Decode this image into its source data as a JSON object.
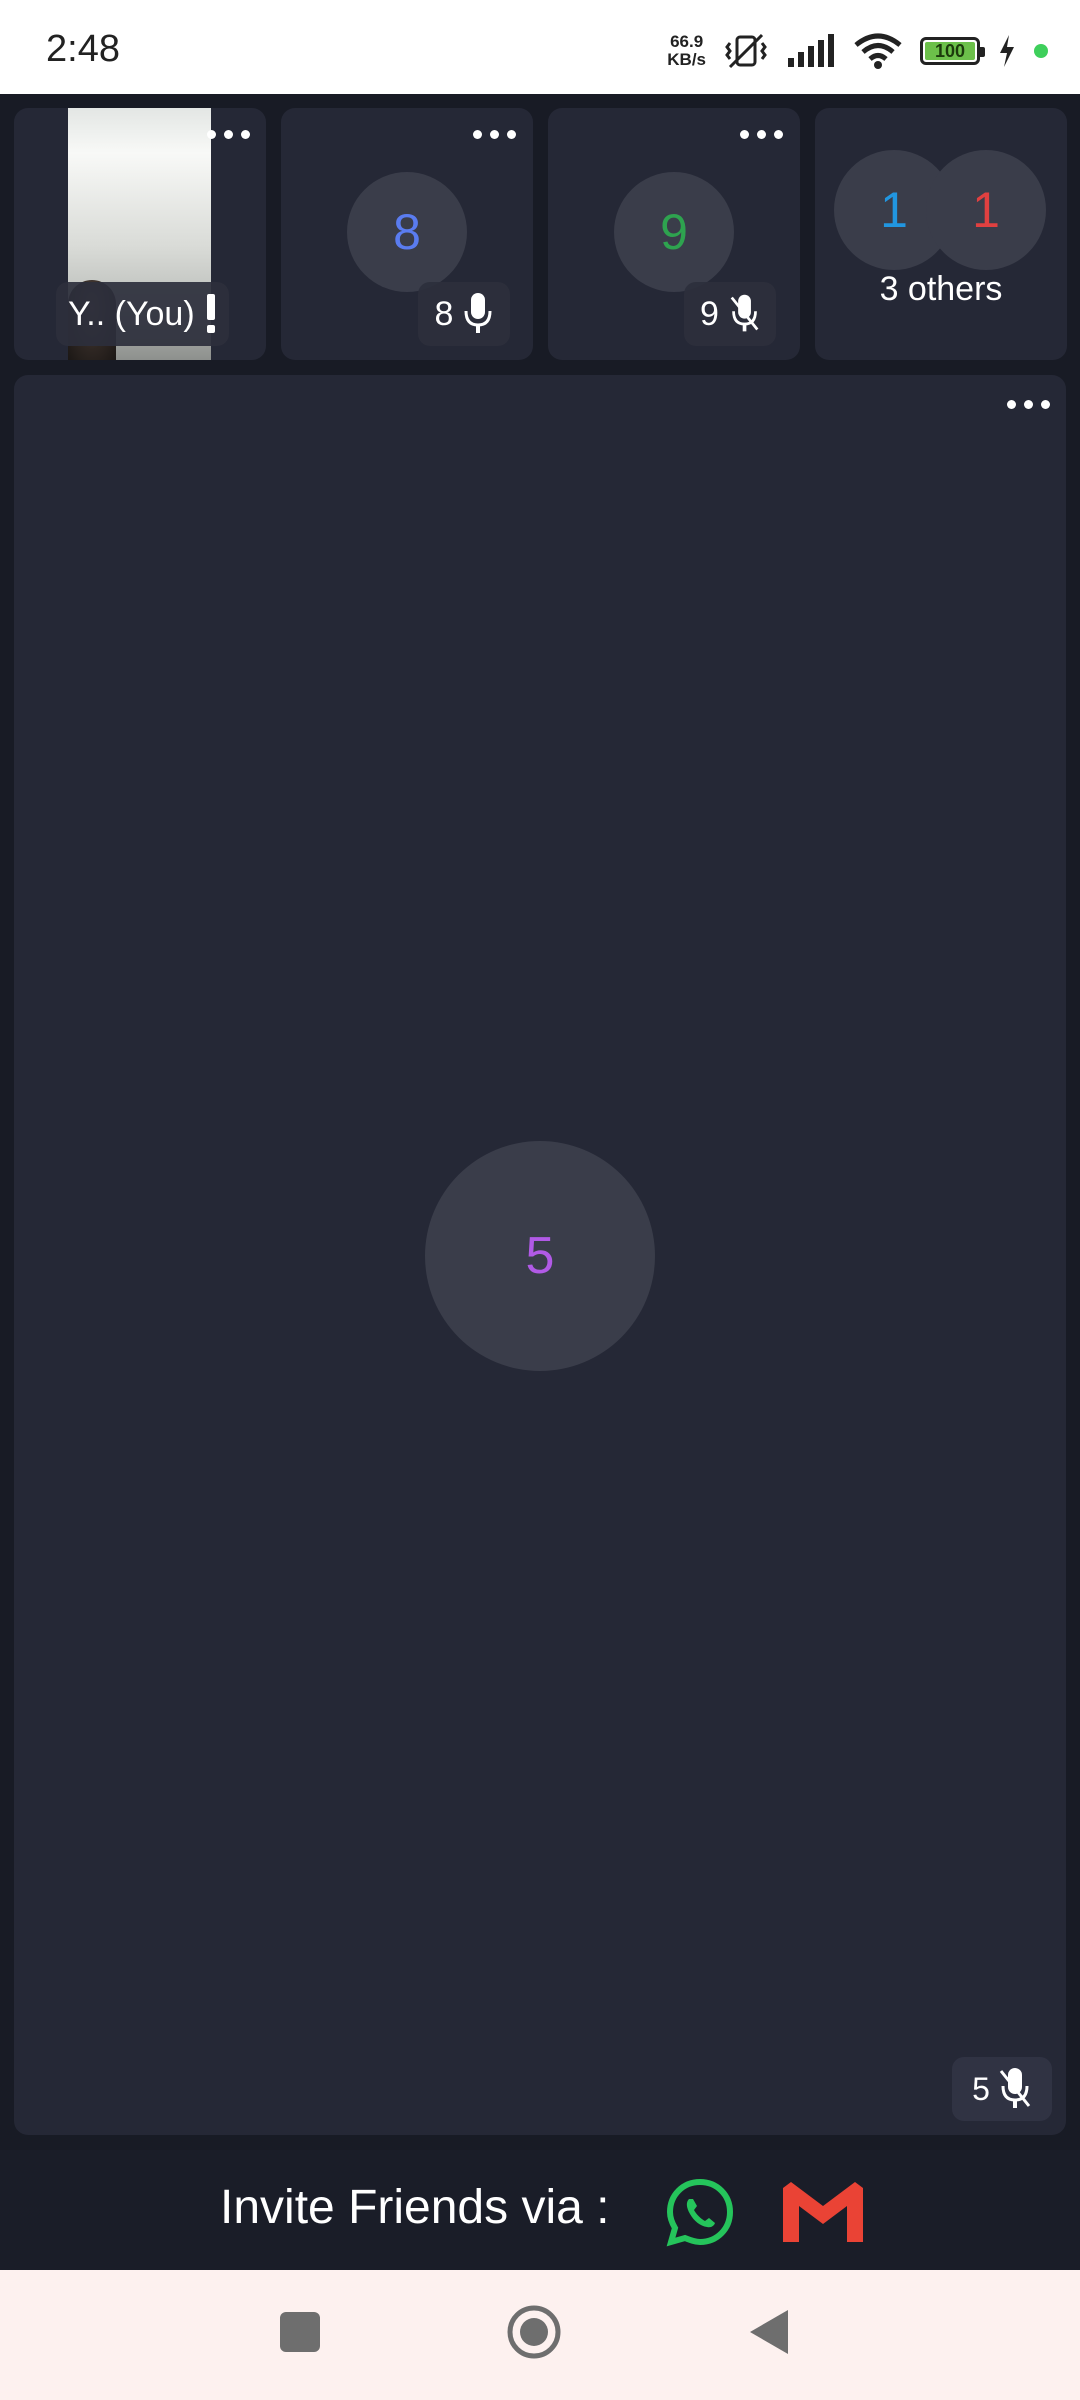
{
  "status_bar": {
    "time": "2:48",
    "network_speed_value": "66.9",
    "network_speed_unit": "KB/s",
    "battery": "100",
    "icons": [
      "vibrate-mute-icon",
      "signal-icon",
      "wifi-icon",
      "battery-icon",
      "charging-icon",
      "active-dot"
    ]
  },
  "participants": [
    {
      "label": "Y.. (You)",
      "status_icon": "exclamation-icon"
    },
    {
      "avatar": "8",
      "label": "8",
      "mic": "mic-on-icon",
      "color": "#5a7cf0"
    },
    {
      "avatar": "9",
      "label": "9",
      "mic": "mic-off-icon",
      "color": "#2ea34f"
    },
    {
      "avatars": [
        "1",
        "1"
      ],
      "avatar_colors": [
        "#2196e0",
        "#e04040"
      ],
      "label": "3 others"
    }
  ],
  "main_speaker": {
    "avatar": "5",
    "label": "5",
    "mic": "mic-off-icon",
    "color": "#b15ae6"
  },
  "invite": {
    "text": "Invite Friends via :",
    "options": [
      "whatsapp-icon",
      "gmail-icon"
    ]
  },
  "nav": [
    "recents-button",
    "home-button",
    "back-button"
  ]
}
